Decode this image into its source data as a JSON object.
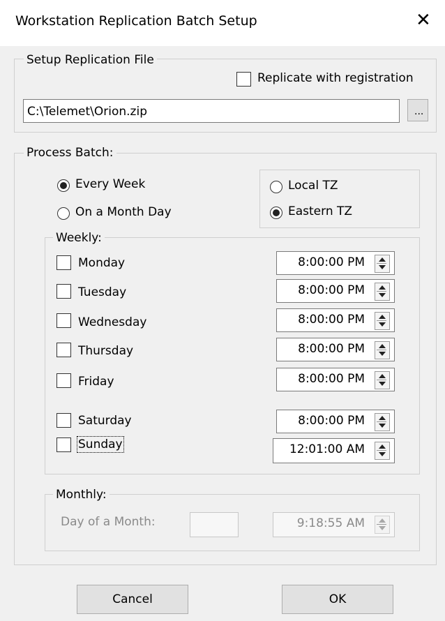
{
  "window": {
    "title": "Workstation Replication Batch Setup"
  },
  "setup": {
    "legend": "Setup Replication File",
    "replicate_label": "Replicate with registration",
    "file_path": "C:\\Telemet\\Orion.zip",
    "browse_label": "..."
  },
  "process": {
    "legend": "Process Batch:",
    "every_week_label": "Every Week",
    "month_day_label": "On a Month Day",
    "local_tz_label": "Local TZ",
    "eastern_tz_label": "Eastern TZ"
  },
  "weekly": {
    "legend": "Weekly:",
    "days": [
      {
        "label": "Monday",
        "time": "8:00:00 PM"
      },
      {
        "label": "Tuesday",
        "time": "8:00:00 PM"
      },
      {
        "label": "Wednesday",
        "time": "8:00:00 PM"
      },
      {
        "label": "Thursday",
        "time": "8:00:00 PM"
      },
      {
        "label": "Friday",
        "time": "8:00:00 PM"
      },
      {
        "label": "Saturday",
        "time": "8:00:00 PM"
      },
      {
        "label": "Sunday",
        "time": "12:01:00 AM"
      }
    ]
  },
  "monthly": {
    "legend": "Monthly:",
    "day_label": "Day of a Month:",
    "day_value": "",
    "time": "9:18:55 AM"
  },
  "buttons": {
    "cancel": "Cancel",
    "ok": "OK"
  }
}
